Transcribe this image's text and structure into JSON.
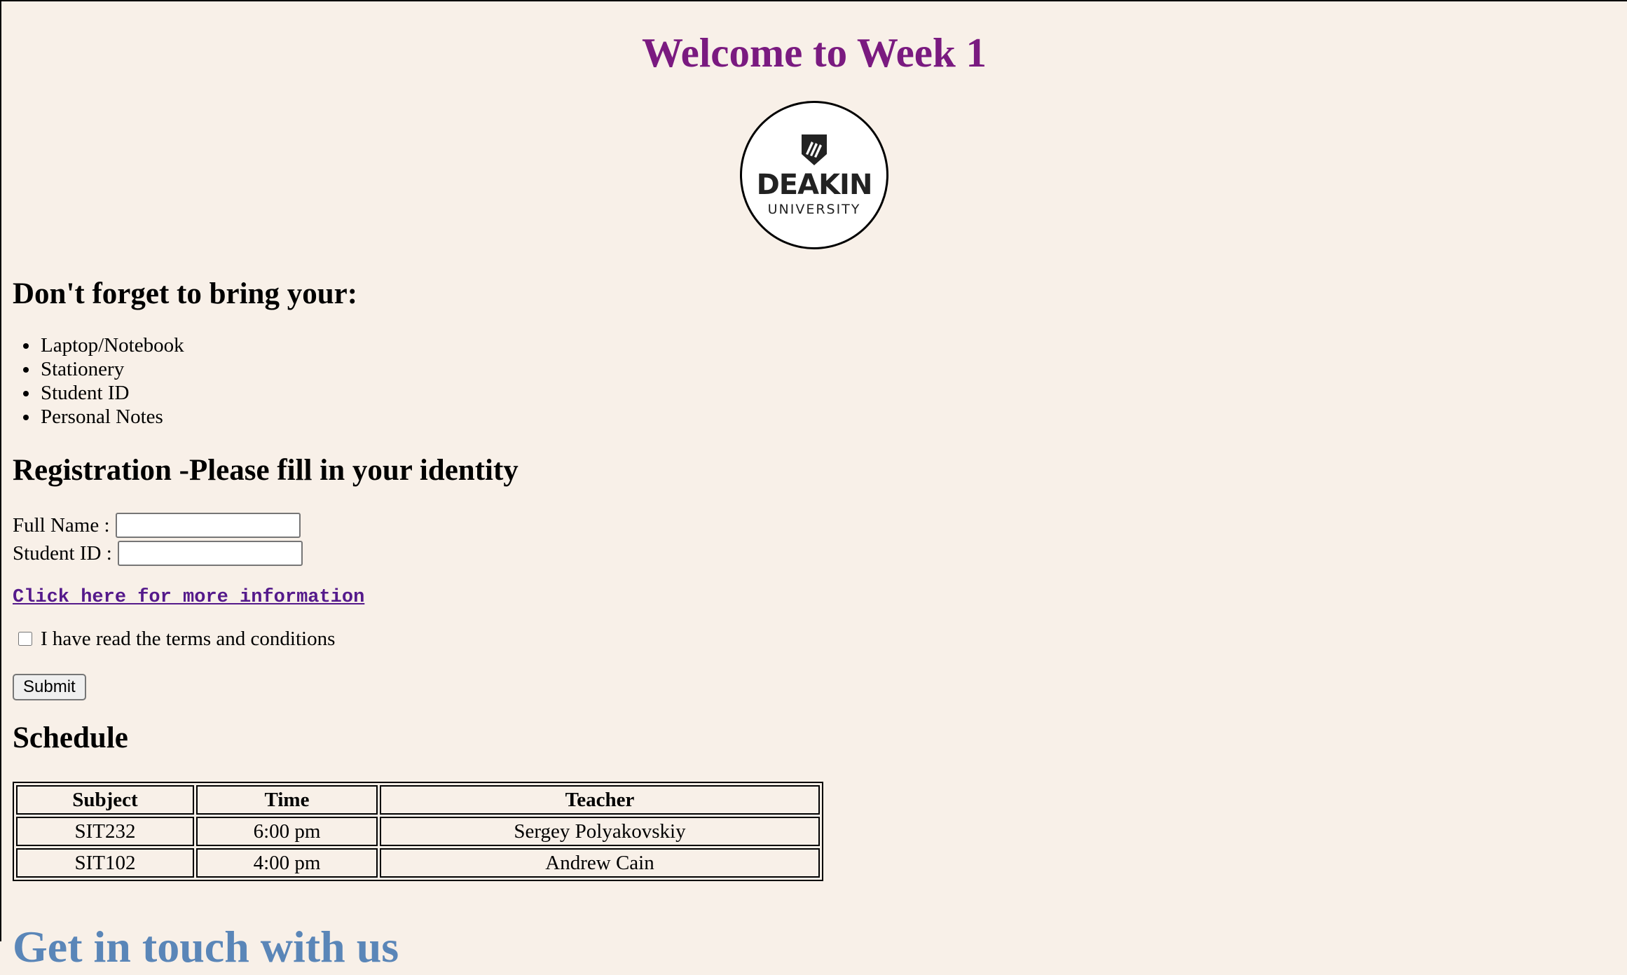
{
  "header": {
    "title": "Welcome to Week 1"
  },
  "logo": {
    "wordmark": "DEAKIN",
    "subtitle": "UNIVERSITY",
    "icon": "deakin-shield-icon"
  },
  "bring": {
    "heading": "Don't forget to bring your:",
    "items": [
      "Laptop/Notebook",
      "Stationery",
      "Student ID",
      "Personal Notes"
    ]
  },
  "registration": {
    "heading": "Registration -Please fill in your identity",
    "full_name_label": "Full Name :",
    "full_name_value": "",
    "student_id_label": "Student ID :",
    "student_id_value": "",
    "more_info_link": "Click here for more information",
    "terms_label": "I have read the terms and conditions",
    "terms_checked": false,
    "submit_label": "Submit"
  },
  "schedule": {
    "heading": "Schedule",
    "columns": [
      "Subject",
      "Time",
      "Teacher"
    ],
    "rows": [
      [
        "SIT232",
        "6:00 pm",
        "Sergey Polyakovskiy"
      ],
      [
        "SIT102",
        "4:00 pm",
        "Andrew Cain"
      ]
    ]
  },
  "contact": {
    "heading": "Get in touch with us"
  },
  "colors": {
    "background": "#f8f0e8",
    "title": "#7a1a80",
    "link": "#551a8b",
    "contact_heading": "#5a86b8"
  }
}
